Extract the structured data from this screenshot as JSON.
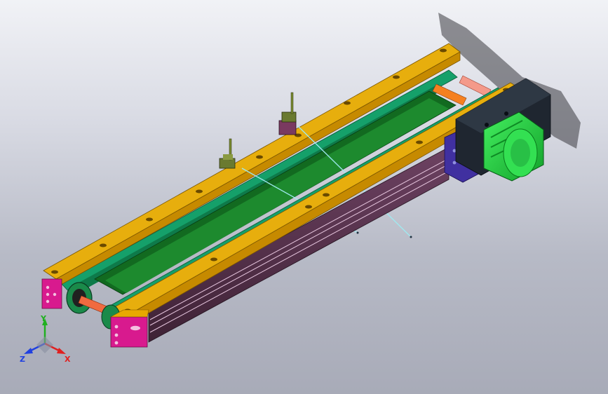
{
  "viewport": {
    "background_top": "#f1f2f6",
    "background_bottom": "#a8abb8"
  },
  "model": {
    "parts": [
      {
        "name": "rail",
        "color": "#e8a800"
      },
      {
        "name": "belt",
        "color": "#1e8a5a"
      },
      {
        "name": "frame-profile",
        "color": "#5a3550"
      },
      {
        "name": "end-block",
        "color": "#d81a8e"
      },
      {
        "name": "shaft",
        "color": "#f06a40"
      },
      {
        "name": "motor",
        "color": "#22cc44"
      },
      {
        "name": "motor-mount",
        "color": "#4030a0"
      },
      {
        "name": "sensor",
        "color": "#6a7a30"
      }
    ]
  },
  "triad": {
    "x_label": "X",
    "y_label": "Y",
    "z_label": "Z",
    "x_color": "#e02020",
    "y_color": "#20b020",
    "z_color": "#2040e0"
  }
}
